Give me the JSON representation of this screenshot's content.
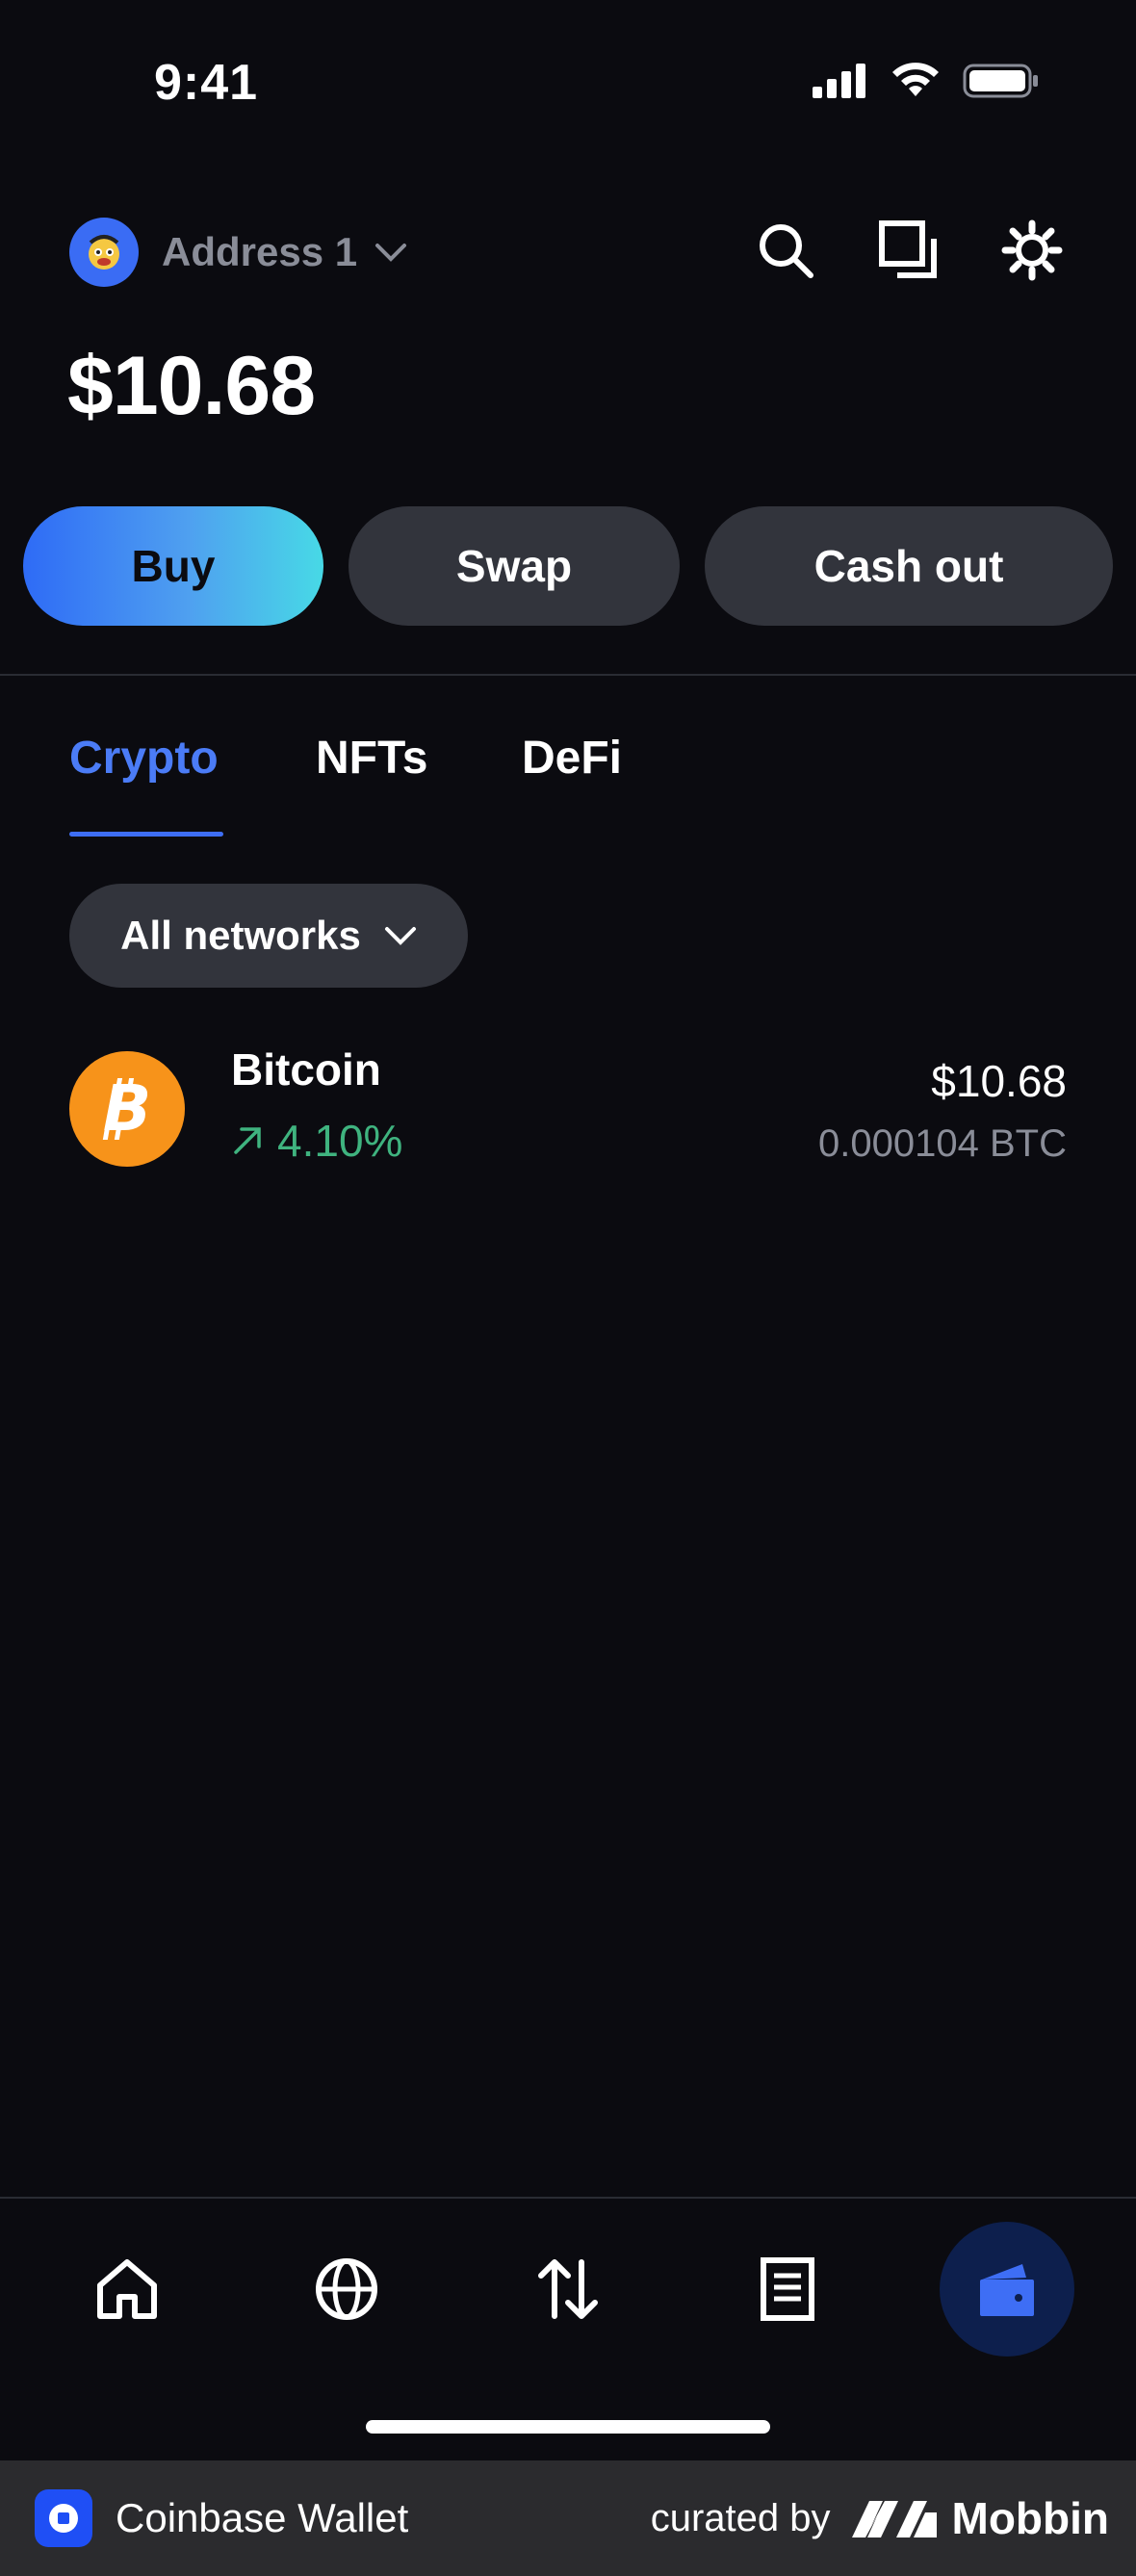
{
  "status_bar": {
    "time": "9:41"
  },
  "header": {
    "address_label": "Address 1",
    "balance": "$10.68"
  },
  "actions": {
    "buy": "Buy",
    "swap": "Swap",
    "cash_out": "Cash out"
  },
  "tabs": [
    {
      "label": "Crypto",
      "active": true
    },
    {
      "label": "NFTs",
      "active": false
    },
    {
      "label": "DeFi",
      "active": false
    }
  ],
  "filter": {
    "label": "All networks"
  },
  "assets": [
    {
      "name": "Bitcoin",
      "change": "4.10%",
      "value": "$10.68",
      "amount": "0.000104 BTC",
      "icon": "bitcoin-icon"
    }
  ],
  "bottom_nav": [
    {
      "icon": "home-icon",
      "active": false
    },
    {
      "icon": "globe-icon",
      "active": false
    },
    {
      "icon": "transfer-arrows-icon",
      "active": false
    },
    {
      "icon": "document-icon",
      "active": false
    },
    {
      "icon": "wallet-icon",
      "active": true
    }
  ],
  "footer": {
    "app_name": "Coinbase Wallet",
    "curated_by": "curated by",
    "brand": "Mobbin"
  },
  "colors": {
    "background": "#0b0b10",
    "accent": "#3e6ef5",
    "positive": "#3fb37f",
    "bitcoin": "#f7931a",
    "button": "#32343c"
  }
}
